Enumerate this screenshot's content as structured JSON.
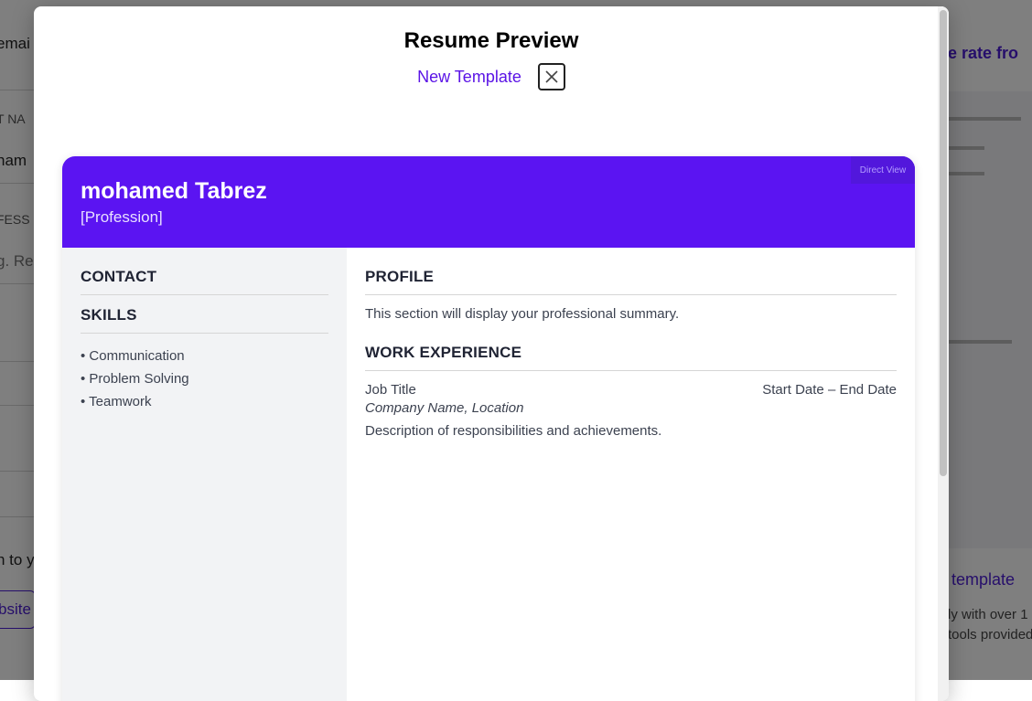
{
  "background": {
    "left_fragments": [
      "emai",
      "T NA",
      "ham",
      "FESS",
      "g. Re",
      "n to y",
      "bsite"
    ],
    "right_title": "se rate fro",
    "right_link": "template",
    "right_para": [
      "ly with over 1",
      "tools provided"
    ]
  },
  "modal": {
    "title": "Resume Preview",
    "new_template_label": "New Template",
    "close_icon": "close-icon"
  },
  "resume": {
    "name": "mohamed Tabrez",
    "profession": "[Profession]",
    "direct_view_label": "Direct View",
    "accent_color": "#5b14f2",
    "sidebar": {
      "contact_title": "CONTACT",
      "skills_title": "SKILLS",
      "skills": [
        "• Communication",
        "• Problem Solving",
        "• Teamwork"
      ]
    },
    "main": {
      "profile_title": "PROFILE",
      "profile_text": "This section will display your professional summary.",
      "experience_title": "WORK EXPERIENCE",
      "job_title": "Job Title",
      "job_dates": "Start Date – End Date",
      "company": "Company Name, Location",
      "description": "Description of responsibilities and achievements."
    }
  }
}
